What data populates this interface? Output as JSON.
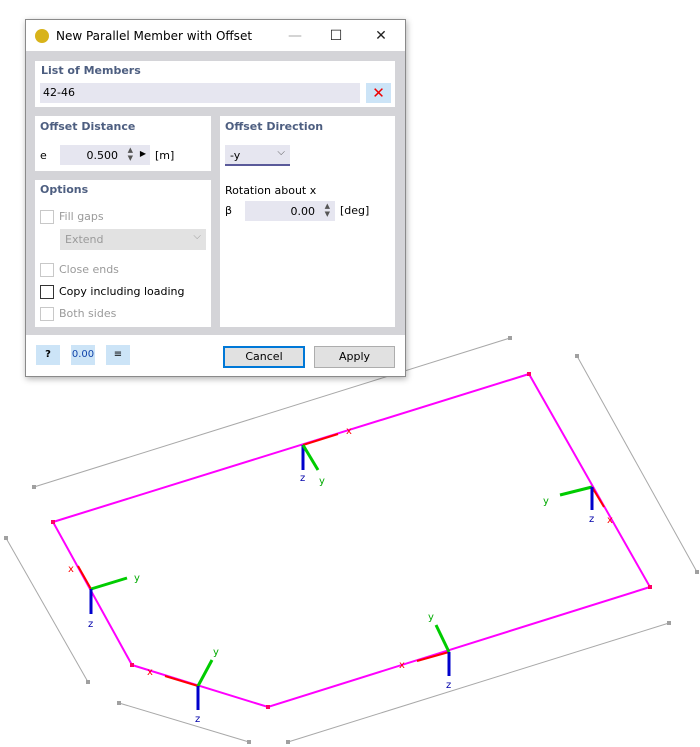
{
  "dialog": {
    "title": "New Parallel Member with Offset",
    "window_buttons": {
      "minimize": "—",
      "maximize": "☐",
      "close": "✕"
    },
    "list_of_members": {
      "heading": "List of Members",
      "value": "42-46"
    },
    "offset_distance": {
      "heading": "Offset Distance",
      "symbol": "e",
      "value": "0.500",
      "unit": "[m]"
    },
    "offset_direction": {
      "heading": "Offset Direction",
      "selected": "-y"
    },
    "rotation": {
      "heading": "Rotation about x",
      "symbol": "β",
      "value": "0.00",
      "unit": "[deg]"
    },
    "options": {
      "heading": "Options",
      "fill_gaps": {
        "label": "Fill gaps",
        "checked": false,
        "enabled": false
      },
      "fill_mode": {
        "selected": "Extend",
        "enabled": false
      },
      "close_ends": {
        "label": "Close ends",
        "checked": false,
        "enabled": false
      },
      "copy_loading": {
        "label": "Copy including loading",
        "checked": false,
        "enabled": true
      },
      "both_sides": {
        "label": "Both sides",
        "checked": false,
        "enabled": false
      }
    },
    "footer": {
      "units_icon_text": "0.00",
      "cancel": "Cancel",
      "apply": "Apply"
    }
  },
  "scene": {
    "colors": {
      "member": "#ff00ff",
      "x_axis": "#ff0000",
      "y_axis": "#00cc00",
      "z_axis": "#0000cc",
      "dimension": "#a0a0a0"
    },
    "axis_labels": {
      "x": "x",
      "y": "y",
      "z": "z"
    }
  }
}
